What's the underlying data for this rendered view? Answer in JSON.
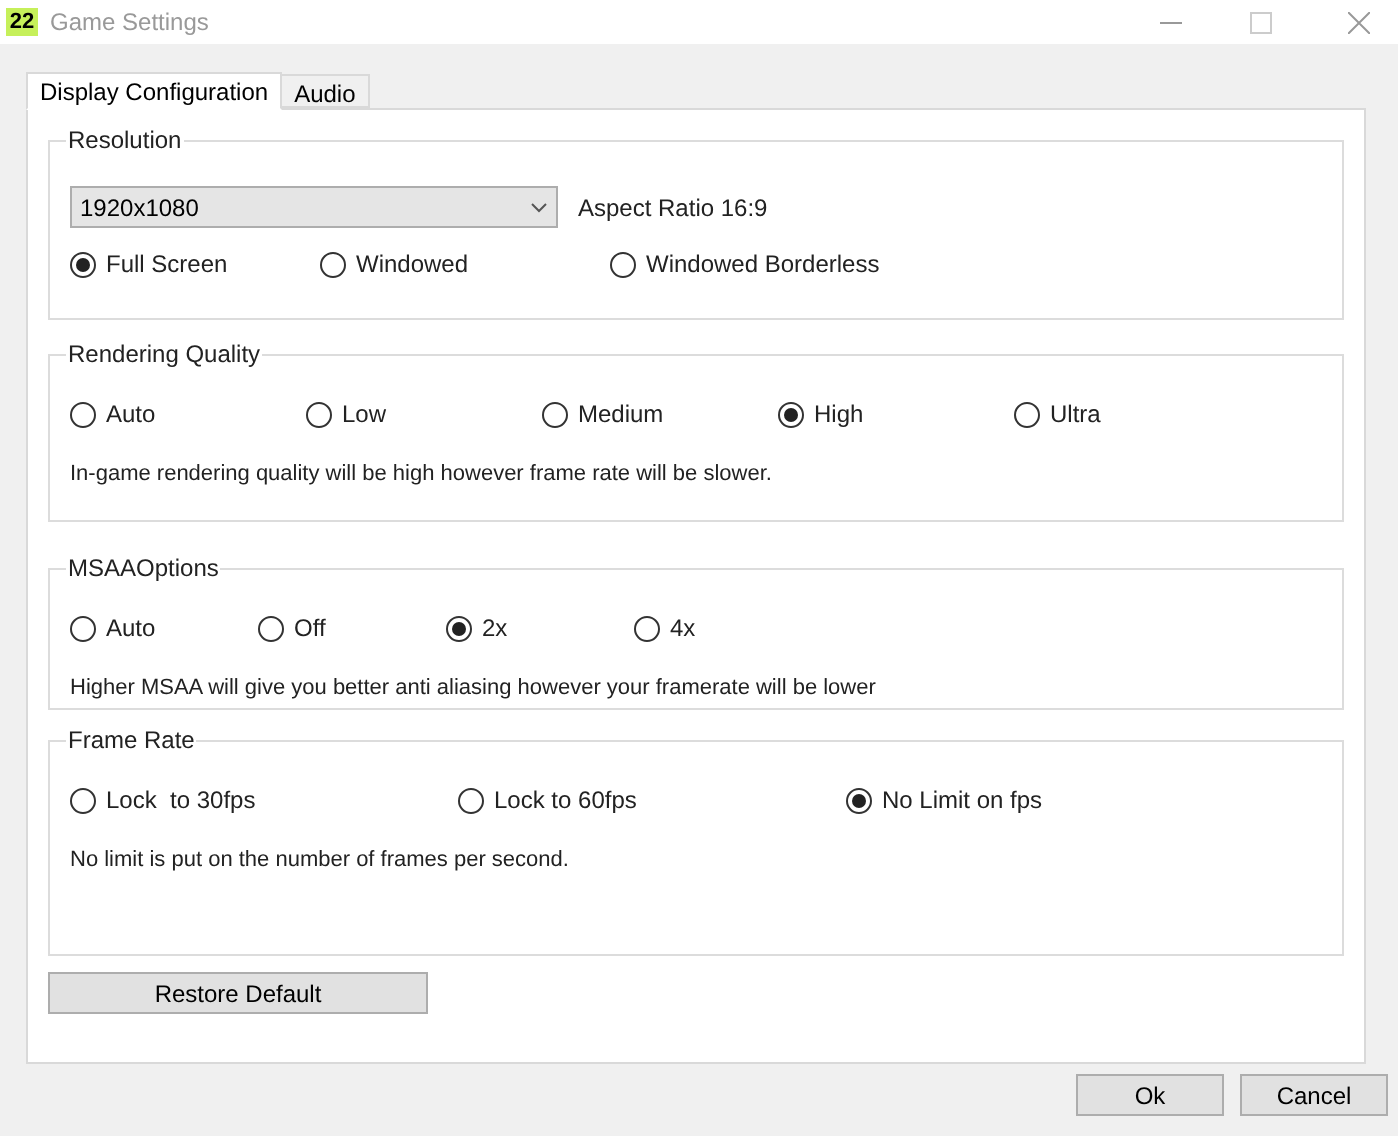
{
  "window": {
    "icon_text": "22",
    "title": "Game Settings"
  },
  "tabs": [
    {
      "label": "Display Configuration",
      "selected": true
    },
    {
      "label": "Audio",
      "selected": false
    }
  ],
  "groups": [
    {
      "title": "Resolution",
      "dropdown": {
        "value": "1920x1080"
      },
      "aspect": "Aspect Ratio 16:9",
      "options": [
        {
          "label": "Full Screen",
          "selected": true
        },
        {
          "label": "Windowed",
          "selected": false
        },
        {
          "label": "Windowed Borderless",
          "selected": false
        }
      ]
    },
    {
      "title": "Rendering Quality",
      "options": [
        {
          "label": "Auto",
          "selected": false
        },
        {
          "label": "Low",
          "selected": false
        },
        {
          "label": "Medium",
          "selected": false
        },
        {
          "label": "High",
          "selected": true
        },
        {
          "label": "Ultra",
          "selected": false
        }
      ],
      "description": "In-game rendering quality will be high however frame rate will be slower."
    },
    {
      "title": "MSAAOptions",
      "options": [
        {
          "label": "Auto",
          "selected": false
        },
        {
          "label": "Off",
          "selected": false
        },
        {
          "label": "2x",
          "selected": true
        },
        {
          "label": "4x",
          "selected": false
        }
      ],
      "description": "Higher MSAA will give you better anti aliasing however your framerate will be lower"
    },
    {
      "title": "Frame Rate",
      "options": [
        {
          "label": "Lock  to 30fps",
          "selected": false
        },
        {
          "label": "Lock to 60fps",
          "selected": false
        },
        {
          "label": "No Limit on fps",
          "selected": true
        }
      ],
      "description": "No limit is put on the number of frames per second."
    }
  ],
  "restore_button": "Restore Default",
  "buttons": [
    "Ok",
    "Cancel"
  ]
}
